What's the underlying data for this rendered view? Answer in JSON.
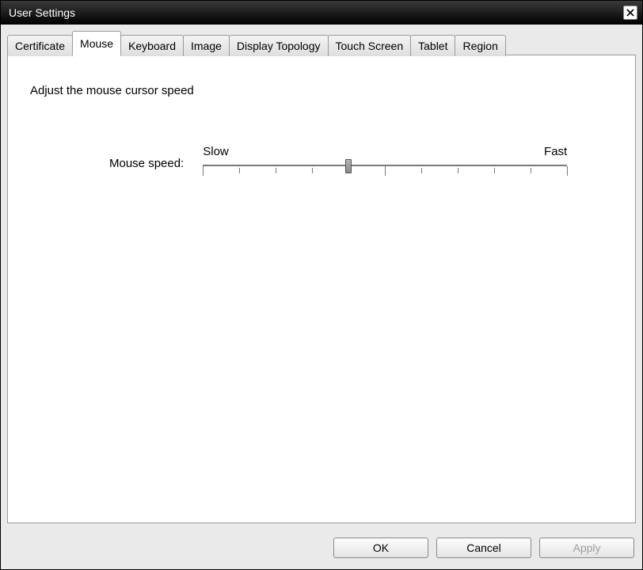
{
  "window": {
    "title": "User Settings"
  },
  "tabs": [
    {
      "label": "Certificate",
      "active": false
    },
    {
      "label": "Mouse",
      "active": true
    },
    {
      "label": "Keyboard",
      "active": false
    },
    {
      "label": "Image",
      "active": false
    },
    {
      "label": "Display Topology",
      "active": false
    },
    {
      "label": "Touch Screen",
      "active": false
    },
    {
      "label": "Tablet",
      "active": false
    },
    {
      "label": "Region",
      "active": false
    }
  ],
  "panel": {
    "instruction": "Adjust the mouse cursor speed",
    "slider_label": "Mouse speed:",
    "slow_label": "Slow",
    "fast_label": "Fast",
    "slider": {
      "min": 0,
      "max": 10,
      "value": 4,
      "ticks": 11
    }
  },
  "buttons": {
    "ok": "OK",
    "cancel": "Cancel",
    "apply": "Apply"
  }
}
